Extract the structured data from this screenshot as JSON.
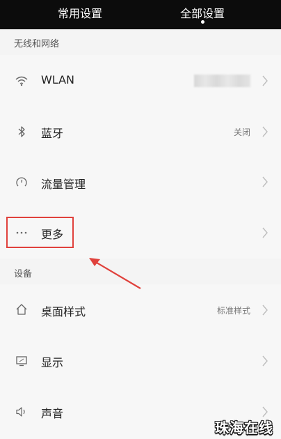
{
  "tabs": {
    "common": "常用设置",
    "all": "全部设置",
    "active": "all"
  },
  "sections": {
    "wireless": {
      "title": "无线和网络",
      "items": {
        "wlan": {
          "label": "WLAN",
          "icon": "wifi-icon"
        },
        "bluetooth": {
          "label": "蓝牙",
          "value": "关闭",
          "icon": "bluetooth-icon"
        },
        "data": {
          "label": "流量管理",
          "icon": "data-usage-icon"
        },
        "more": {
          "label": "更多",
          "icon": "more-dots-icon"
        }
      }
    },
    "device": {
      "title": "设备",
      "items": {
        "home": {
          "label": "桌面样式",
          "value": "标准样式",
          "icon": "home-icon"
        },
        "display": {
          "label": "显示",
          "icon": "display-icon"
        },
        "sound": {
          "label": "声音",
          "icon": "speaker-icon"
        }
      }
    }
  },
  "annotation": {
    "highlight_color": "#e0413c"
  },
  "watermark": {
    "text": "珠海在线"
  }
}
